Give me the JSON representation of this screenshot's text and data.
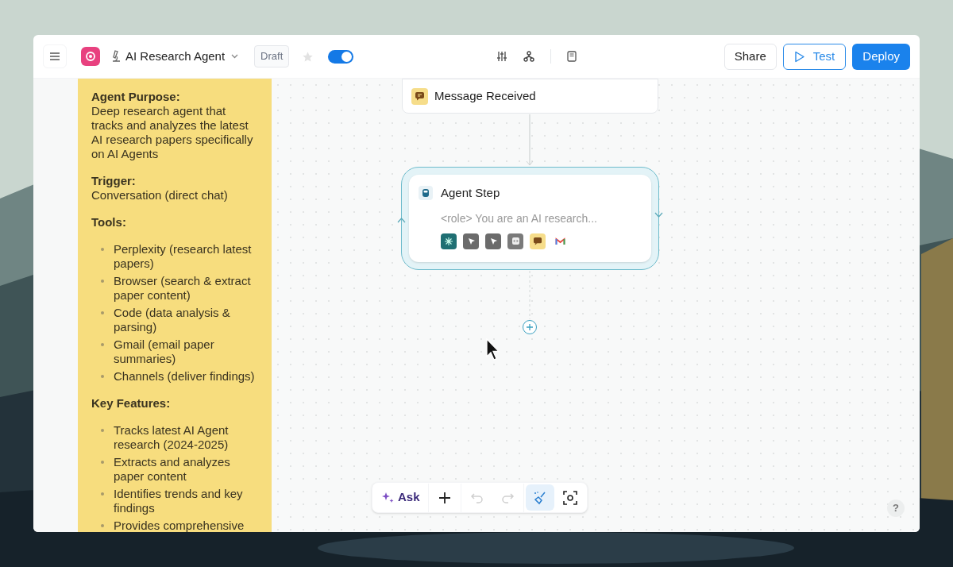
{
  "header": {
    "title": "AI Research Agent",
    "status_badge": "Draft",
    "starred": false,
    "enabled": true,
    "buttons": [
      {
        "label": "Share",
        "kind": "plain"
      },
      {
        "label": "Test",
        "kind": "outline"
      },
      {
        "label": "Deploy",
        "kind": "primary"
      }
    ]
  },
  "note": {
    "sections": [
      {
        "heading": "Agent Purpose:",
        "kind": "text",
        "text": "Deep research agent that tracks and analyzes the latest AI research papers specifically on AI Agents"
      },
      {
        "heading": "Trigger:",
        "kind": "text",
        "text": "Conversation (direct chat)"
      },
      {
        "heading": "Tools:",
        "kind": "list",
        "items": [
          "Perplexity (research latest papers)",
          "Browser (search & extract paper content)",
          "Code (data analysis & parsing)",
          "Gmail (email paper summaries)",
          "Channels (deliver findings)"
        ]
      },
      {
        "heading": "Key Features:",
        "kind": "list",
        "items": [
          "Tracks latest AI Agent research (2024-2025)",
          "Extracts and analyzes paper content",
          "Identifies trends and key findings",
          "Provides comprehensive"
        ]
      }
    ]
  },
  "canvas": {
    "trigger_node": {
      "title": "Message Received"
    },
    "agent_node": {
      "title": "Agent Step",
      "prompt": "<role> You are an AI research..."
    },
    "toolbar": [
      {
        "kind": "ask",
        "label": "Ask",
        "disabled": false,
        "selected": false
      },
      {
        "kind": "add",
        "disabled": false,
        "selected": false
      },
      {
        "kind": "undo",
        "disabled": true,
        "selected": false
      },
      {
        "kind": "redo",
        "disabled": true,
        "selected": false
      },
      {
        "kind": "clean",
        "disabled": false,
        "selected": true
      },
      {
        "kind": "focus",
        "disabled": false,
        "selected": false
      }
    ],
    "help": "?"
  }
}
